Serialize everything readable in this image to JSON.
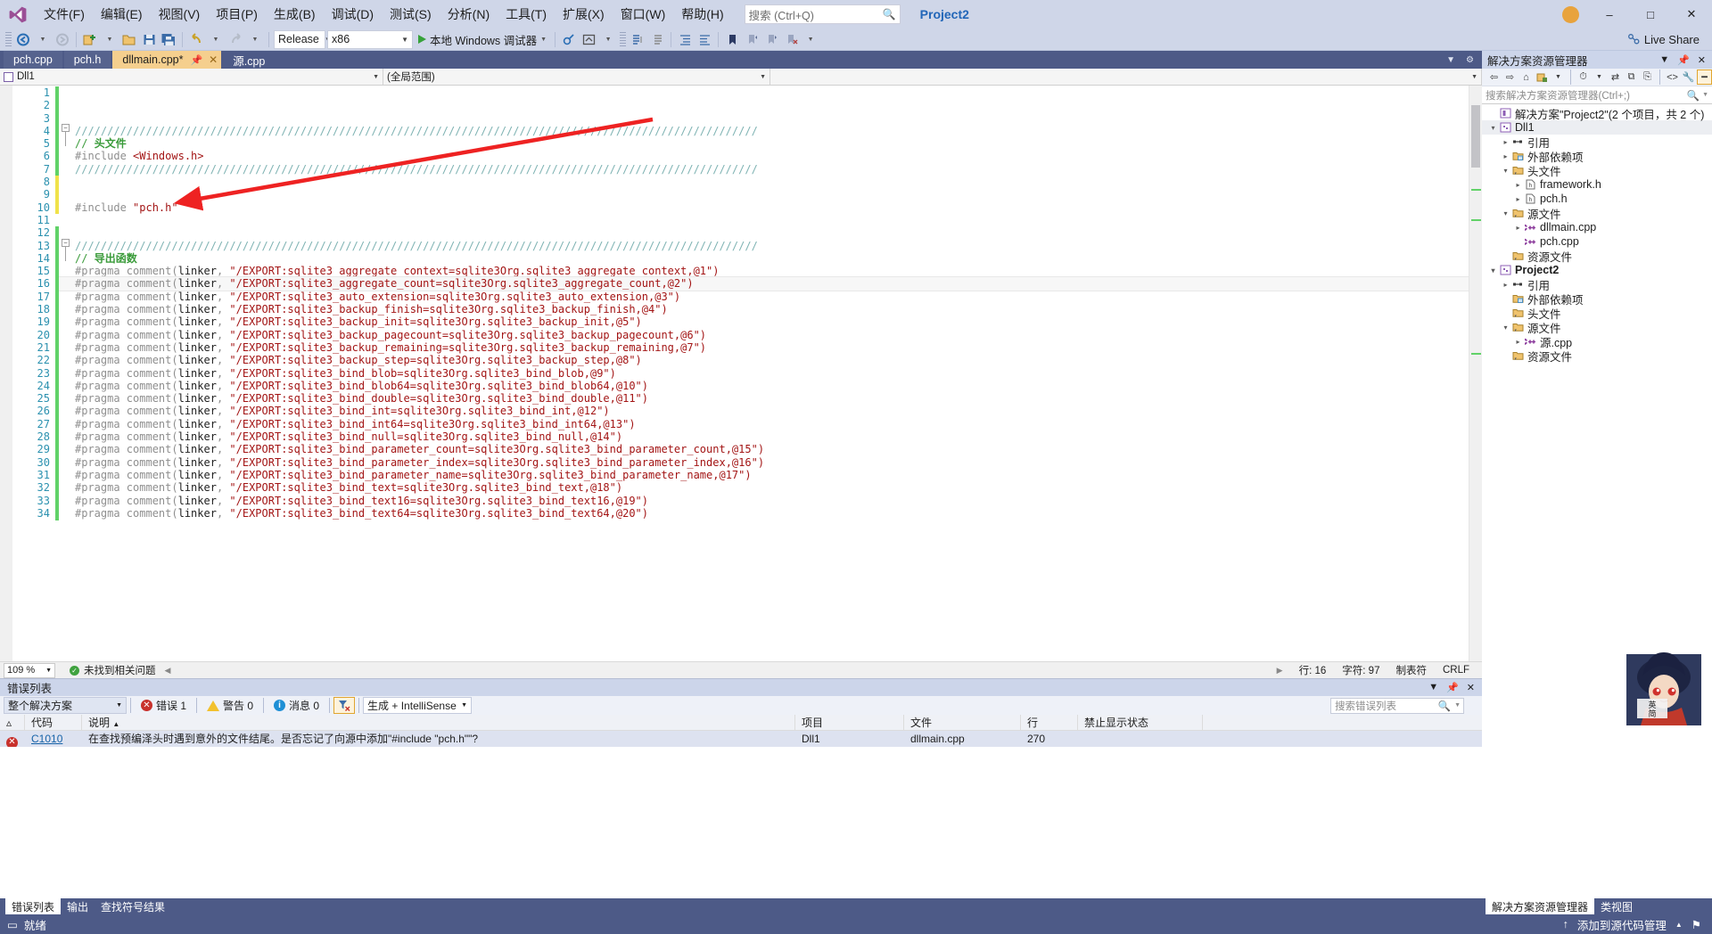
{
  "window": {
    "project_label": "Project2",
    "live_share": "Live Share"
  },
  "menu": {
    "items": [
      "文件(F)",
      "编辑(E)",
      "视图(V)",
      "项目(P)",
      "生成(B)",
      "调试(D)",
      "测试(S)",
      "分析(N)",
      "工具(T)",
      "扩展(X)",
      "窗口(W)",
      "帮助(H)"
    ],
    "search_placeholder": "搜索 (Ctrl+Q)"
  },
  "toolbar": {
    "config": "Release",
    "platform": "x86",
    "run_label": "本地 Windows 调试器"
  },
  "tabs": [
    {
      "label": "pch.cpp",
      "state": "inactive"
    },
    {
      "label": "pch.h",
      "state": "inactive"
    },
    {
      "label": "dllmain.cpp*",
      "state": "active"
    },
    {
      "label": "源.cpp",
      "state": "plain"
    }
  ],
  "navbar": {
    "scope": "Dll1",
    "member": "(全局范围)",
    "third": ""
  },
  "editor": {
    "zoom": "109 %",
    "issue_status": "未找到相关问题",
    "line_label": "行: 16",
    "char_label": "字符: 97",
    "tab_label": "制表符",
    "eol_label": "CRLF",
    "lines": [
      {
        "n": 1,
        "text": "",
        "type": "blank",
        "mark": "green"
      },
      {
        "n": 2,
        "text": "",
        "type": "blank",
        "mark": "green"
      },
      {
        "n": 3,
        "text": "",
        "type": "blank",
        "mark": "green"
      },
      {
        "n": 4,
        "text": "//////////////////////////////////////////////////////////////////////////////////////////////////////////",
        "type": "slashes",
        "mark": "green"
      },
      {
        "n": 5,
        "text": "// 头文件",
        "type": "comment-bold",
        "mark": "green"
      },
      {
        "n": 6,
        "text": "#include <Windows.h>",
        "type": "include-angle",
        "mark": "green"
      },
      {
        "n": 7,
        "text": "//////////////////////////////////////////////////////////////////////////////////////////////////////////",
        "type": "slashes",
        "mark": "green"
      },
      {
        "n": 8,
        "text": "",
        "type": "blank",
        "mark": "yellow"
      },
      {
        "n": 9,
        "text": "",
        "type": "blank",
        "mark": "yellow"
      },
      {
        "n": 10,
        "text": "#include \"pch.h\"",
        "type": "include-quote",
        "mark": "yellow"
      },
      {
        "n": 11,
        "text": "",
        "type": "blank",
        "mark": "none"
      },
      {
        "n": 12,
        "text": "",
        "type": "blank",
        "mark": "green"
      },
      {
        "n": 13,
        "text": "//////////////////////////////////////////////////////////////////////////////////////////////////////////",
        "type": "slashes",
        "mark": "green"
      },
      {
        "n": 14,
        "text": "// 导出函数",
        "type": "comment-bold",
        "mark": "green"
      },
      {
        "n": 15,
        "text": "#pragma comment(linker, \"/EXPORT:sqlite3_aggregate_context=sqlite3Org.sqlite3_aggregate_context,@1\")",
        "type": "pragma",
        "mark": "green"
      },
      {
        "n": 16,
        "text": "#pragma comment(linker, \"/EXPORT:sqlite3_aggregate_count=sqlite3Org.sqlite3_aggregate_count,@2\")",
        "type": "pragma",
        "mark": "green",
        "current": true
      },
      {
        "n": 17,
        "text": "#pragma comment(linker, \"/EXPORT:sqlite3_auto_extension=sqlite3Org.sqlite3_auto_extension,@3\")",
        "type": "pragma",
        "mark": "green"
      },
      {
        "n": 18,
        "text": "#pragma comment(linker, \"/EXPORT:sqlite3_backup_finish=sqlite3Org.sqlite3_backup_finish,@4\")",
        "type": "pragma",
        "mark": "green"
      },
      {
        "n": 19,
        "text": "#pragma comment(linker, \"/EXPORT:sqlite3_backup_init=sqlite3Org.sqlite3_backup_init,@5\")",
        "type": "pragma",
        "mark": "green"
      },
      {
        "n": 20,
        "text": "#pragma comment(linker, \"/EXPORT:sqlite3_backup_pagecount=sqlite3Org.sqlite3_backup_pagecount,@6\")",
        "type": "pragma",
        "mark": "green"
      },
      {
        "n": 21,
        "text": "#pragma comment(linker, \"/EXPORT:sqlite3_backup_remaining=sqlite3Org.sqlite3_backup_remaining,@7\")",
        "type": "pragma",
        "mark": "green"
      },
      {
        "n": 22,
        "text": "#pragma comment(linker, \"/EXPORT:sqlite3_backup_step=sqlite3Org.sqlite3_backup_step,@8\")",
        "type": "pragma",
        "mark": "green"
      },
      {
        "n": 23,
        "text": "#pragma comment(linker, \"/EXPORT:sqlite3_bind_blob=sqlite3Org.sqlite3_bind_blob,@9\")",
        "type": "pragma",
        "mark": "green"
      },
      {
        "n": 24,
        "text": "#pragma comment(linker, \"/EXPORT:sqlite3_bind_blob64=sqlite3Org.sqlite3_bind_blob64,@10\")",
        "type": "pragma",
        "mark": "green"
      },
      {
        "n": 25,
        "text": "#pragma comment(linker, \"/EXPORT:sqlite3_bind_double=sqlite3Org.sqlite3_bind_double,@11\")",
        "type": "pragma",
        "mark": "green"
      },
      {
        "n": 26,
        "text": "#pragma comment(linker, \"/EXPORT:sqlite3_bind_int=sqlite3Org.sqlite3_bind_int,@12\")",
        "type": "pragma",
        "mark": "green"
      },
      {
        "n": 27,
        "text": "#pragma comment(linker, \"/EXPORT:sqlite3_bind_int64=sqlite3Org.sqlite3_bind_int64,@13\")",
        "type": "pragma",
        "mark": "green"
      },
      {
        "n": 28,
        "text": "#pragma comment(linker, \"/EXPORT:sqlite3_bind_null=sqlite3Org.sqlite3_bind_null,@14\")",
        "type": "pragma",
        "mark": "green"
      },
      {
        "n": 29,
        "text": "#pragma comment(linker, \"/EXPORT:sqlite3_bind_parameter_count=sqlite3Org.sqlite3_bind_parameter_count,@15\")",
        "type": "pragma",
        "mark": "green"
      },
      {
        "n": 30,
        "text": "#pragma comment(linker, \"/EXPORT:sqlite3_bind_parameter_index=sqlite3Org.sqlite3_bind_parameter_index,@16\")",
        "type": "pragma",
        "mark": "green"
      },
      {
        "n": 31,
        "text": "#pragma comment(linker, \"/EXPORT:sqlite3_bind_parameter_name=sqlite3Org.sqlite3_bind_parameter_name,@17\")",
        "type": "pragma",
        "mark": "green"
      },
      {
        "n": 32,
        "text": "#pragma comment(linker, \"/EXPORT:sqlite3_bind_text=sqlite3Org.sqlite3_bind_text,@18\")",
        "type": "pragma",
        "mark": "green"
      },
      {
        "n": 33,
        "text": "#pragma comment(linker, \"/EXPORT:sqlite3_bind_text16=sqlite3Org.sqlite3_bind_text16,@19\")",
        "type": "pragma",
        "mark": "green"
      },
      {
        "n": 34,
        "text": "#pragma comment(linker, \"/EXPORT:sqlite3_bind_text64=sqlite3Org.sqlite3_bind_text64,@20\")",
        "type": "pragma",
        "mark": "green"
      }
    ]
  },
  "error_list": {
    "title": "错误列表",
    "scope": "整个解决方案",
    "errors_label": "错误 1",
    "warnings_label": "警告 0",
    "messages_label": "消息 0",
    "build_filter": "生成 + IntelliSense",
    "search_placeholder": "搜索错误列表",
    "columns": [
      "",
      "代码",
      "说明",
      "项目",
      "文件",
      "行",
      "禁止显示状态"
    ],
    "rows": [
      {
        "severity": "error",
        "code": "C1010",
        "description": "在查找预编泽头时遇到意外的文件结尾。是否忘记了向源中添加\"#include \"pch.h\"\"?",
        "project": "Dll1",
        "file": "dllmain.cpp",
        "line": "270",
        "suppression": ""
      }
    ],
    "bottom_tabs": [
      "错误列表",
      "输出",
      "查找符号结果"
    ]
  },
  "solution_explorer": {
    "title": "解决方案资源管理器",
    "search_placeholder": "搜索解决方案资源管理器(Ctrl+;)",
    "tree": [
      {
        "label": "解决方案\"Project2\"(2 个项目，共 2 个)",
        "depth": 0,
        "twisty": "none",
        "icon": "solution-icon",
        "bold": false
      },
      {
        "label": "Dll1",
        "depth": 0,
        "twisty": "open",
        "icon": "project-icon",
        "bold": false,
        "selected": true
      },
      {
        "label": "引用",
        "depth": 1,
        "twisty": "closed",
        "icon": "references-icon",
        "bold": false
      },
      {
        "label": "外部依赖项",
        "depth": 1,
        "twisty": "closed",
        "icon": "folder-icon",
        "bold": false
      },
      {
        "label": "头文件",
        "depth": 1,
        "twisty": "open",
        "icon": "filter-folder-icon",
        "bold": false
      },
      {
        "label": "framework.h",
        "depth": 2,
        "twisty": "closed",
        "icon": "header-file-icon",
        "bold": false
      },
      {
        "label": "pch.h",
        "depth": 2,
        "twisty": "closed",
        "icon": "header-file-icon",
        "bold": false
      },
      {
        "label": "源文件",
        "depth": 1,
        "twisty": "open",
        "icon": "filter-folder-icon",
        "bold": false
      },
      {
        "label": "dllmain.cpp",
        "depth": 2,
        "twisty": "closed",
        "icon": "cpp-file-icon",
        "bold": false
      },
      {
        "label": "pch.cpp",
        "depth": 2,
        "twisty": "none",
        "icon": "cpp-file-icon",
        "bold": false
      },
      {
        "label": "资源文件",
        "depth": 1,
        "twisty": "none",
        "icon": "filter-folder-icon",
        "bold": false
      },
      {
        "label": "Project2",
        "depth": 0,
        "twisty": "open",
        "icon": "project-icon",
        "bold": true
      },
      {
        "label": "引用",
        "depth": 1,
        "twisty": "closed",
        "icon": "references-icon",
        "bold": false
      },
      {
        "label": "外部依赖项",
        "depth": 1,
        "twisty": "none",
        "icon": "folder-icon",
        "bold": false
      },
      {
        "label": "头文件",
        "depth": 1,
        "twisty": "none",
        "icon": "filter-folder-icon",
        "bold": false
      },
      {
        "label": "源文件",
        "depth": 1,
        "twisty": "open",
        "icon": "filter-folder-icon",
        "bold": false
      },
      {
        "label": "源.cpp",
        "depth": 2,
        "twisty": "closed",
        "icon": "cpp-file-icon",
        "bold": false
      },
      {
        "label": "资源文件",
        "depth": 1,
        "twisty": "none",
        "icon": "filter-folder-icon",
        "bold": false
      }
    ],
    "bottom_tabs": [
      "解决方案资源管理器",
      "类视图"
    ]
  },
  "statusbar": {
    "state": "就绪",
    "source_control": "添加到源代码管理"
  },
  "colors": {
    "chrome": "#cfd6e8",
    "accent_dark": "#4d5a87",
    "tab_active": "#f5cf8e",
    "error_red": "#c8312c",
    "annotation_arrow": "#ee2222",
    "change_green": "#61d268",
    "change_yellow": "#f0e24a"
  }
}
